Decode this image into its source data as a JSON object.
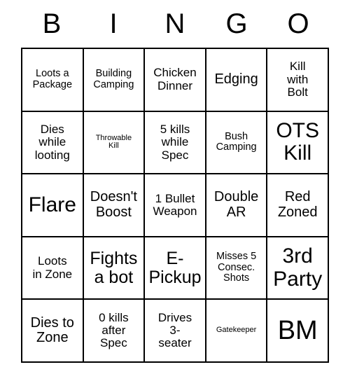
{
  "card": {
    "type": "bingo-card",
    "columns": 5,
    "rows": 5,
    "background_color": "#ffffff",
    "line_color": "#000000",
    "text_color": "#000000"
  },
  "header": {
    "letters": [
      {
        "label": "B"
      },
      {
        "label": "I"
      },
      {
        "label": "N"
      },
      {
        "label": "G"
      },
      {
        "label": "O"
      }
    ]
  },
  "grid": {
    "rows": [
      {
        "cells": [
          {
            "text": "Loots a\nPackage",
            "size": "sm"
          },
          {
            "text": "Building\nCamping",
            "size": "sm"
          },
          {
            "text": "Chicken\nDinner",
            "size": "md"
          },
          {
            "text": "Edging",
            "size": "lg"
          },
          {
            "text": "Kill\nwith\nBolt",
            "size": "md"
          }
        ]
      },
      {
        "cells": [
          {
            "text": "Dies\nwhile\nlooting",
            "size": "md"
          },
          {
            "text": "Throwable\nKill",
            "size": "xs"
          },
          {
            "text": "5 kills\nwhile\nSpec",
            "size": "md"
          },
          {
            "text": "Bush\nCamping",
            "size": "sm"
          },
          {
            "text": "OTS\nKill",
            "size": "xxl"
          }
        ]
      },
      {
        "cells": [
          {
            "text": "Flare",
            "size": "xxl"
          },
          {
            "text": "Doesn't\nBoost",
            "size": "lg"
          },
          {
            "text": "1 Bullet\nWeapon",
            "size": "md"
          },
          {
            "text": "Double\nAR",
            "size": "lg"
          },
          {
            "text": "Red\nZoned",
            "size": "lg"
          }
        ]
      },
      {
        "cells": [
          {
            "text": "Loots\nin Zone",
            "size": "md"
          },
          {
            "text": "Fights\na bot",
            "size": "xl"
          },
          {
            "text": "E-\nPickup",
            "size": "xl"
          },
          {
            "text": "Misses 5\nConsec.\nShots",
            "size": "sm"
          },
          {
            "text": "3rd\nParty",
            "size": "xxl"
          }
        ]
      },
      {
        "cells": [
          {
            "text": "Dies to\nZone",
            "size": "lg"
          },
          {
            "text": "0 kills\nafter\nSpec",
            "size": "md"
          },
          {
            "text": "Drives\n3-\nseater",
            "size": "md"
          },
          {
            "text": "Gatekeeper",
            "size": "xs"
          },
          {
            "text": "BM",
            "size": "huge"
          }
        ]
      }
    ]
  }
}
